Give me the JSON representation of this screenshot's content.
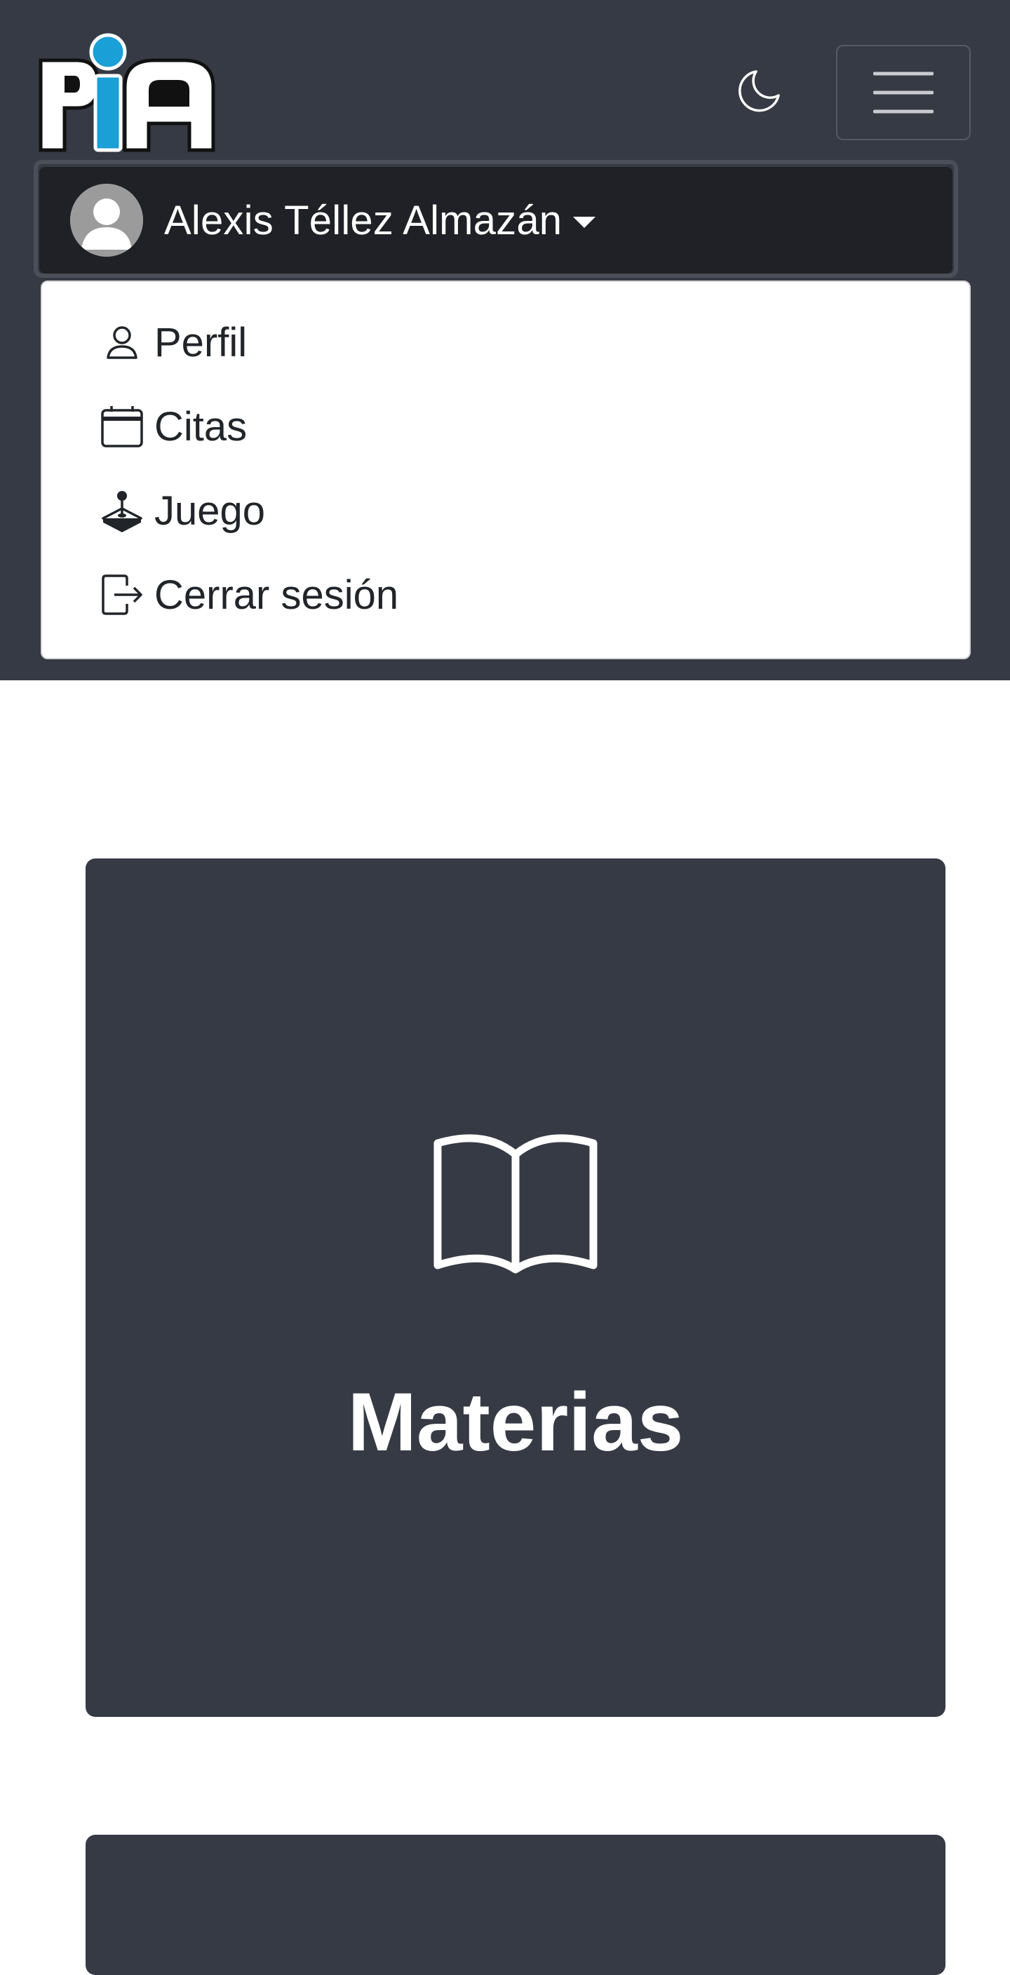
{
  "header": {
    "logo_text": "PIA",
    "theme_toggle_icon": "moon-icon",
    "menu_icon": "hamburger-icon",
    "colors": {
      "navbar_bg": "#363a44",
      "logo_accent": "#1a9fd6"
    }
  },
  "user_menu": {
    "name": "Alexis Téllez Almazán",
    "avatar_icon": "user-avatar-icon",
    "items": [
      {
        "label": "Perfil",
        "icon": "person-icon"
      },
      {
        "label": "Citas",
        "icon": "calendar-icon"
      },
      {
        "label": "Juego",
        "icon": "joystick-icon"
      },
      {
        "label": "Cerrar sesión",
        "icon": "logout-icon"
      }
    ]
  },
  "main": {
    "cards": [
      {
        "title": "Materias",
        "icon": "open-book-icon"
      }
    ]
  }
}
